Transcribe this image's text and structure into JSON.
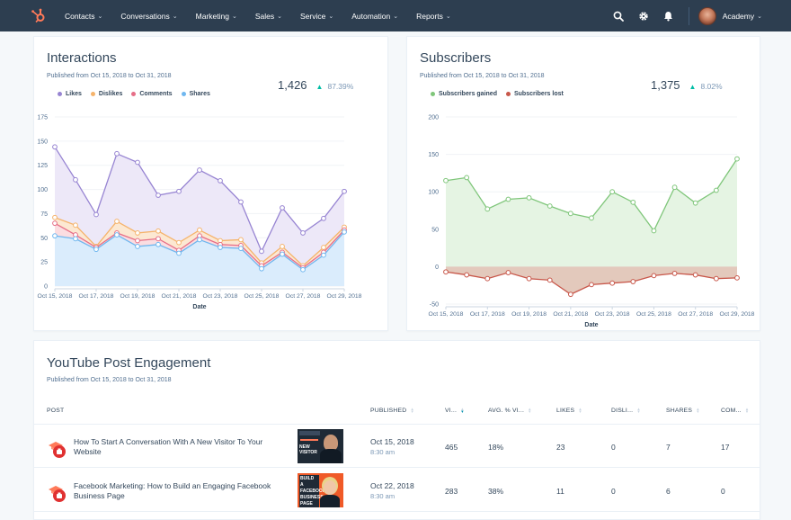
{
  "nav": {
    "logo": "hubspot-sprocket-icon",
    "items": [
      {
        "label": "Contacts"
      },
      {
        "label": "Conversations"
      },
      {
        "label": "Marketing"
      },
      {
        "label": "Sales"
      },
      {
        "label": "Service"
      },
      {
        "label": "Automation"
      },
      {
        "label": "Reports"
      }
    ],
    "chevron": "⌄",
    "icons": [
      "search-icon",
      "gear-icon",
      "bell-icon"
    ],
    "account_label": "Academy"
  },
  "interactions": {
    "title": "Interactions",
    "subtitle": "Published from Oct 15, 2018 to Oct 31, 2018",
    "kpi_value": "1,426",
    "kpi_change": "87.39%",
    "kpi_arrow": "▲"
  },
  "subscribers": {
    "title": "Subscribers",
    "subtitle": "Published from Oct 15, 2018 to Oct 31, 2018",
    "kpi_value": "1,375",
    "kpi_change": "8.02%",
    "kpi_arrow": "▲"
  },
  "chart_data": [
    {
      "type": "area",
      "title": "Interactions",
      "xlabel": "Date",
      "ylabel": "",
      "ylim": [
        0,
        175
      ],
      "yticks": [
        0,
        25,
        50,
        75,
        100,
        125,
        150,
        175
      ],
      "grid": true,
      "legend": "top-left",
      "x": [
        "Oct 15, 2018",
        "Oct 16, 2018",
        "Oct 17, 2018",
        "Oct 18, 2018",
        "Oct 19, 2018",
        "Oct 20, 2018",
        "Oct 21, 2018",
        "Oct 22, 2018",
        "Oct 23, 2018",
        "Oct 24, 2018",
        "Oct 25, 2018",
        "Oct 26, 2018",
        "Oct 27, 2018",
        "Oct 28, 2018",
        "Oct 29, 2018"
      ],
      "xtick_labels": [
        "Oct 15, 2018",
        "Oct 17, 2018",
        "Oct 19, 2018",
        "Oct 21, 2018",
        "Oct 23, 2018",
        "Oct 25, 2018",
        "Oct 27, 2018",
        "Oct 29, 2018"
      ],
      "series": [
        {
          "name": "Likes",
          "color": "#9784d2",
          "fill": "#ece7f8",
          "values": [
            144,
            110,
            74,
            137,
            128,
            94,
            98,
            120,
            109,
            87,
            36,
            81,
            55,
            70,
            98
          ]
        },
        {
          "name": "Dislikes",
          "color": "#f5b36b",
          "fill": "#fde8d0",
          "values": [
            71,
            63,
            41,
            67,
            55,
            57,
            45,
            58,
            47,
            48,
            24,
            41,
            21,
            40,
            61
          ]
        },
        {
          "name": "Comments",
          "color": "#e66e87",
          "fill": "#fbdce2",
          "values": [
            65,
            53,
            40,
            55,
            47,
            49,
            37,
            52,
            43,
            42,
            21,
            35,
            19,
            35,
            58
          ]
        },
        {
          "name": "Shares",
          "color": "#6fb7ef",
          "fill": "#d8ecfd",
          "values": [
            52,
            49,
            38,
            53,
            41,
            43,
            34,
            48,
            40,
            39,
            18,
            33,
            17,
            32,
            56
          ]
        }
      ]
    },
    {
      "type": "area",
      "title": "Subscribers",
      "xlabel": "Date",
      "ylabel": "",
      "ylim": [
        -50,
        200
      ],
      "yticks": [
        -50,
        0,
        50,
        100,
        150,
        200
      ],
      "grid": true,
      "legend": "top-left",
      "x": [
        "Oct 15, 2018",
        "Oct 16, 2018",
        "Oct 17, 2018",
        "Oct 18, 2018",
        "Oct 19, 2018",
        "Oct 20, 2018",
        "Oct 21, 2018",
        "Oct 22, 2018",
        "Oct 23, 2018",
        "Oct 24, 2018",
        "Oct 25, 2018",
        "Oct 26, 2018",
        "Oct 27, 2018",
        "Oct 28, 2018",
        "Oct 29, 2018"
      ],
      "xtick_labels": [
        "Oct 15, 2018",
        "Oct 17, 2018",
        "Oct 19, 2018",
        "Oct 21, 2018",
        "Oct 23, 2018",
        "Oct 25, 2018",
        "Oct 27, 2018",
        "Oct 29, 2018"
      ],
      "series": [
        {
          "name": "Subscribers gained",
          "color": "#7fc67a",
          "fill": "#e4f3e1",
          "values": [
            115,
            119,
            77,
            90,
            92,
            81,
            71,
            65,
            100,
            86,
            48,
            106,
            85,
            102,
            144
          ]
        },
        {
          "name": "Subscribers lost",
          "color": "#c8574a",
          "fill": "#e2c6b8",
          "values": [
            -7,
            -11,
            -16,
            -8,
            -16,
            -18,
            -37,
            -24,
            -22,
            -20,
            -12,
            -9,
            -11,
            -16,
            -15
          ]
        }
      ]
    }
  ],
  "engagement": {
    "title": "YouTube Post Engagement",
    "subtitle": "Published from Oct 15, 2018 to Oct 31, 2018",
    "columns": [
      {
        "label": "POST",
        "sortable": false
      },
      {
        "label": "PUBLISHED",
        "sortable": true
      },
      {
        "label": "VI...",
        "sortable": true,
        "active": true
      },
      {
        "label": "AVG. % VI...",
        "sortable": true
      },
      {
        "label": "LIKES",
        "sortable": true
      },
      {
        "label": "DISLI...",
        "sortable": true
      },
      {
        "label": "SHARES",
        "sortable": true
      },
      {
        "label": "COM...",
        "sortable": true
      }
    ],
    "rows": [
      {
        "title": "How To Start A Conversation With A New Visitor To Your Website",
        "thumb_text": "NEW VISITOR",
        "published_date": "Oct 15, 2018",
        "published_time": "8:30 am",
        "views": "465",
        "avg_pct": "18%",
        "likes": "23",
        "dislikes": "0",
        "shares": "7",
        "comments": "17"
      },
      {
        "title": "Facebook Marketing: How to Build an Engaging Facebook Business Page",
        "thumb_text": "BUILD A FACEBOOK BUSINESS PAGE",
        "published_date": "Oct 22, 2018",
        "published_time": "8:30 am",
        "views": "283",
        "avg_pct": "38%",
        "likes": "11",
        "dislikes": "0",
        "shares": "6",
        "comments": "0"
      }
    ]
  }
}
